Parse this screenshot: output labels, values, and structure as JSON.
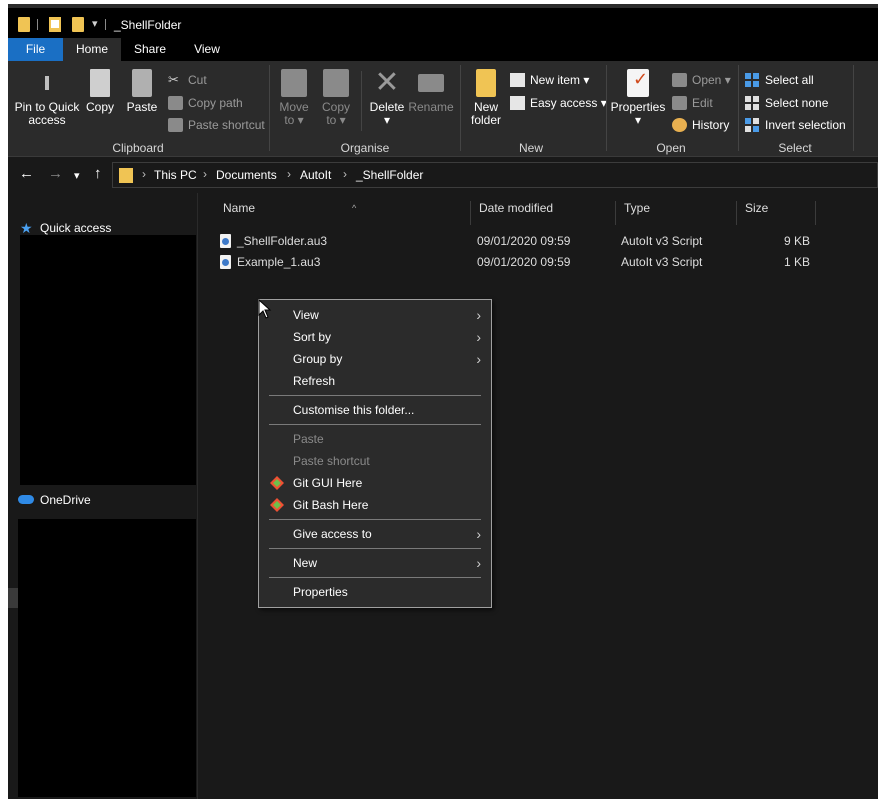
{
  "window": {
    "title": "_ShellFolder"
  },
  "ribbon_tabs": [
    "File",
    "Home",
    "Share",
    "View"
  ],
  "ribbon": {
    "clipboard": {
      "label": "Clipboard",
      "pin": "Pin to Quick access",
      "pin_line1": "Pin to Quick",
      "pin_line2": "access",
      "copy": "Copy",
      "paste": "Paste",
      "cut": "Cut",
      "copy_path": "Copy path",
      "paste_shortcut": "Paste shortcut"
    },
    "organise": {
      "label": "Organise",
      "move_to_1": "Move",
      "move_to_2": "to",
      "copy_to_1": "Copy",
      "copy_to_2": "to",
      "delete": "Delete",
      "rename": "Rename"
    },
    "new": {
      "label": "New",
      "new_folder_1": "New",
      "new_folder_2": "folder",
      "new_item": "New item",
      "easy_access": "Easy access"
    },
    "open": {
      "label": "Open",
      "properties": "Properties",
      "open": "Open",
      "edit": "Edit",
      "history": "History"
    },
    "select": {
      "label": "Select",
      "select_all": "Select all",
      "select_none": "Select none",
      "invert_selection": "Invert selection"
    }
  },
  "breadcrumb": [
    "This PC",
    "Documents",
    "AutoIt",
    "_ShellFolder"
  ],
  "navpane": {
    "quick_access": "Quick access",
    "onedrive": "OneDrive"
  },
  "columns": {
    "name": "Name",
    "date": "Date modified",
    "type": "Type",
    "size": "Size"
  },
  "files": [
    {
      "name": "_ShellFolder.au3",
      "date": "09/01/2020 09:59",
      "type": "AutoIt v3 Script",
      "size": "9 KB"
    },
    {
      "name": "Example_1.au3",
      "date": "09/01/2020 09:59",
      "type": "AutoIt v3 Script",
      "size": "1 KB"
    }
  ],
  "context_menu": {
    "view": "View",
    "sort_by": "Sort by",
    "group_by": "Group by",
    "refresh": "Refresh",
    "customise": "Customise this folder...",
    "paste": "Paste",
    "paste_shortcut": "Paste shortcut",
    "git_gui": "Git GUI Here",
    "git_bash": "Git Bash Here",
    "give_access": "Give access to",
    "new": "New",
    "properties": "Properties"
  },
  "colors": {
    "accent": "#1a6fc4",
    "background": "#191919",
    "ribbon": "#2b2b2b",
    "folder": "#f0c454"
  }
}
